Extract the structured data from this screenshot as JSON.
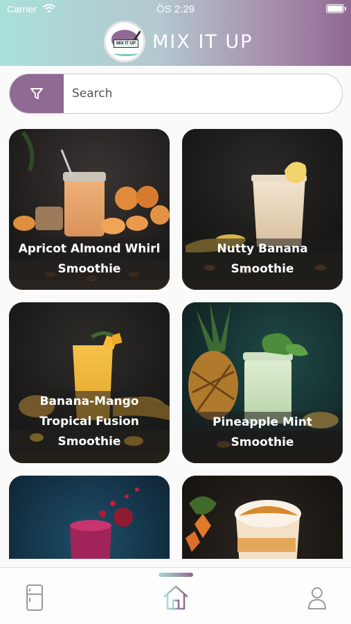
{
  "status_bar": {
    "carrier": "Carrier",
    "time": "ÖS 2:29"
  },
  "header": {
    "title": "MIX IT UP",
    "logo_text": "MIX IT UP"
  },
  "search": {
    "placeholder": "Search",
    "filter_icon": "filter-icon"
  },
  "recipes": [
    {
      "name": "Apricot Almond Whirl Smoothie",
      "line1": "Apricot Almond Whirl",
      "line2": "Smoothie"
    },
    {
      "name": "Nutty Banana Smoothie",
      "line1": "Nutty Banana",
      "line2": "Smoothie"
    },
    {
      "name": "Banana-Mango Tropical Fusion Smoothie",
      "line1": "Banana-Mango",
      "line2": "Tropical Fusion",
      "line3": "Smoothie"
    },
    {
      "name": "Pineapple Mint Smoothie",
      "line1": "Pineapple Mint",
      "line2": "Smoothie"
    }
  ],
  "tabbar": {
    "items": [
      {
        "icon": "fridge-icon"
      },
      {
        "icon": "home-icon",
        "active": true
      },
      {
        "icon": "profile-icon"
      }
    ]
  },
  "colors": {
    "brand_purple": "#8f6a93",
    "brand_teal": "#a9e0d9"
  }
}
